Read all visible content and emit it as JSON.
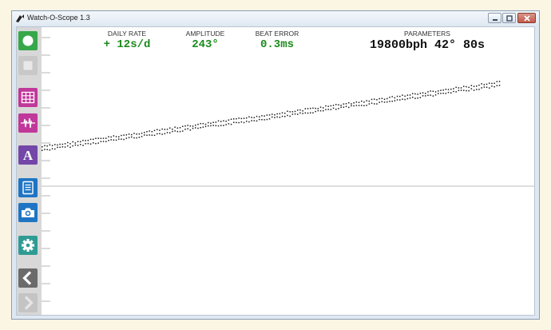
{
  "window": {
    "title": "Watch-O-Scope 1.3"
  },
  "colors": {
    "value_green": "#1c8a1c",
    "parameters_black": "#111111",
    "start_button": "#36a84a",
    "stop_button": "#c8c8c8",
    "grid_button": "#c0389a",
    "waveform_button": "#c0389a",
    "text_button": "#7346a8",
    "log_button": "#1f75c4",
    "camera_button": "#1f75c4",
    "settings_button": "#2e9c94",
    "back_button": "#6b6b6b",
    "forward_button": "#c4c4c4"
  },
  "toolbar": [
    {
      "name": "start-button",
      "icon": "circle-icon",
      "enabled": true
    },
    {
      "name": "stop-button",
      "icon": "square-icon",
      "enabled": false
    },
    {
      "name": "grid-button",
      "icon": "grid-icon",
      "enabled": true
    },
    {
      "name": "waveform-button",
      "icon": "waveform-icon",
      "enabled": true
    },
    {
      "name": "text-button",
      "icon": "letter-a-icon",
      "enabled": true
    },
    {
      "name": "log-button",
      "icon": "document-icon",
      "enabled": true
    },
    {
      "name": "camera-button",
      "icon": "camera-icon",
      "enabled": true
    },
    {
      "name": "settings-button",
      "icon": "gear-icon",
      "enabled": true
    },
    {
      "name": "back-button",
      "icon": "chevron-left-icon",
      "enabled": true
    },
    {
      "name": "forward-button",
      "icon": "chevron-right-icon",
      "enabled": false
    }
  ],
  "readouts": {
    "daily_rate": {
      "label": "DAILY RATE",
      "value": "+ 12s/d"
    },
    "amplitude": {
      "label": "AMPLITUDE",
      "value": "243°"
    },
    "beat_error": {
      "label": "BEAT ERROR",
      "value": "0.3ms"
    },
    "parameters": {
      "label": "PARAMETERS",
      "value": "19800bph 42° 80s"
    }
  },
  "plot": {
    "trace_color": "#1a1a1a",
    "baseline_color": "#bdbdbd",
    "trend_start": 0.58,
    "trend_end": 1.0
  }
}
